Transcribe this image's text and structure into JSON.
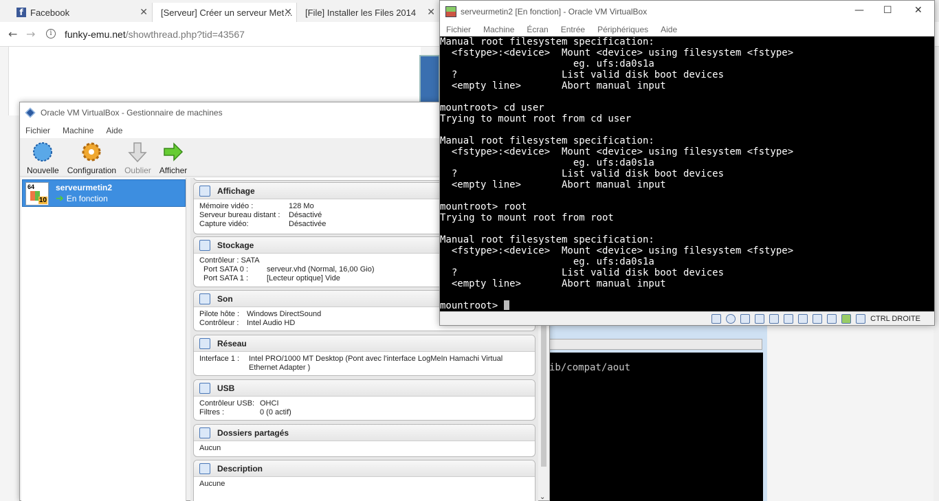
{
  "browser": {
    "tabs": [
      {
        "label": "Facebook",
        "favicon": "facebook-icon"
      },
      {
        "label": "[Serveur] Créer un serveur Met…"
      },
      {
        "label": "[File] Installer les Files 2014"
      }
    ],
    "url_domain": "funky-emu.net",
    "url_path": "/showthread.php?tid=43567"
  },
  "bg_console_text": "ib/compat/aout",
  "manager": {
    "title": "Oracle VM VirtualBox - Gestionnaire de machines",
    "menu": [
      "Fichier",
      "Machine",
      "Aide"
    ],
    "toolbar": [
      {
        "label": "Nouvelle",
        "icon": "new-icon"
      },
      {
        "label": "Configuration",
        "icon": "gear-icon"
      },
      {
        "label": "Oublier",
        "icon": "discard-arrow-icon"
      },
      {
        "label": "Afficher",
        "icon": "show-arrow-icon"
      }
    ],
    "vm": {
      "name": "serveurmetin2",
      "state": "En fonction",
      "os_badge_top": "64",
      "os_badge_bottom": "10"
    },
    "sections": {
      "display": {
        "title": "Affichage",
        "rows": [
          {
            "k": "Mémoire vidéo :",
            "v": "128 Mo"
          },
          {
            "k": "Serveur bureau distant :",
            "v": "Désactivé"
          },
          {
            "k": "Capture vidéo:",
            "v": "Désactivée"
          }
        ]
      },
      "storage": {
        "title": "Stockage",
        "controller": "Contrôleur : SATA",
        "rows": [
          {
            "k": "Port SATA 0 :",
            "v": "serveur.vhd (Normal, 16,00 Gio)"
          },
          {
            "k": "Port SATA 1 :",
            "v": "[Lecteur optique] Vide"
          }
        ]
      },
      "audio": {
        "title": "Son",
        "rows": [
          {
            "k": "Pilote hôte :",
            "v": "Windows DirectSound"
          },
          {
            "k": "Contrôleur :",
            "v": "Intel Audio HD"
          }
        ]
      },
      "network": {
        "title": "Réseau",
        "rows": [
          {
            "k": "Interface 1 :",
            "v": "Intel PRO/1000 MT Desktop (Pont avec l'interface LogMeIn Hamachi Virtual Ethernet Adapter )"
          }
        ]
      },
      "usb": {
        "title": "USB",
        "rows": [
          {
            "k": "Contrôleur USB:",
            "v": "OHCI"
          },
          {
            "k": "Filtres :",
            "v": "0 (0 actif)"
          }
        ]
      },
      "shared": {
        "title": "Dossiers partagés",
        "value": "Aucun"
      },
      "description": {
        "title": "Description",
        "value": "Aucune"
      }
    }
  },
  "vmwindow": {
    "title": "serveurmetin2 [En fonction] - Oracle VM VirtualBox",
    "menu": [
      "Fichier",
      "Machine",
      "Écran",
      "Entrée",
      "Périphériques",
      "Aide"
    ],
    "console_lines": [
      "Manual root filesystem specification:",
      "  <fstype>:<device>  Mount <device> using filesystem <fstype>",
      "                       eg. ufs:da0s1a",
      "  ?                  List valid disk boot devices",
      "  <empty line>       Abort manual input",
      "",
      "mountroot> cd user",
      "Trying to mount root from cd user",
      "",
      "Manual root filesystem specification:",
      "  <fstype>:<device>  Mount <device> using filesystem <fstype>",
      "                       eg. ufs:da0s1a",
      "  ?                  List valid disk boot devices",
      "  <empty line>       Abort manual input",
      "",
      "mountroot> root",
      "Trying to mount root from root",
      "",
      "Manual root filesystem specification:",
      "  <fstype>:<device>  Mount <device> using filesystem <fstype>",
      "                       eg. ufs:da0s1a",
      "  ?                  List valid disk boot devices",
      "  <empty line>       Abort manual input",
      ""
    ],
    "prompt": "mountroot> ",
    "host_key": "CTRL DROITE",
    "status_icons": [
      "hard-disk-icon",
      "optical-drive-icon",
      "audio-icon",
      "network-icon",
      "usb-icon",
      "shared-folder-icon",
      "display-icon",
      "video-capture-icon",
      "cpu-icon",
      "mouse-integration-icon",
      "host-key-icon"
    ]
  }
}
